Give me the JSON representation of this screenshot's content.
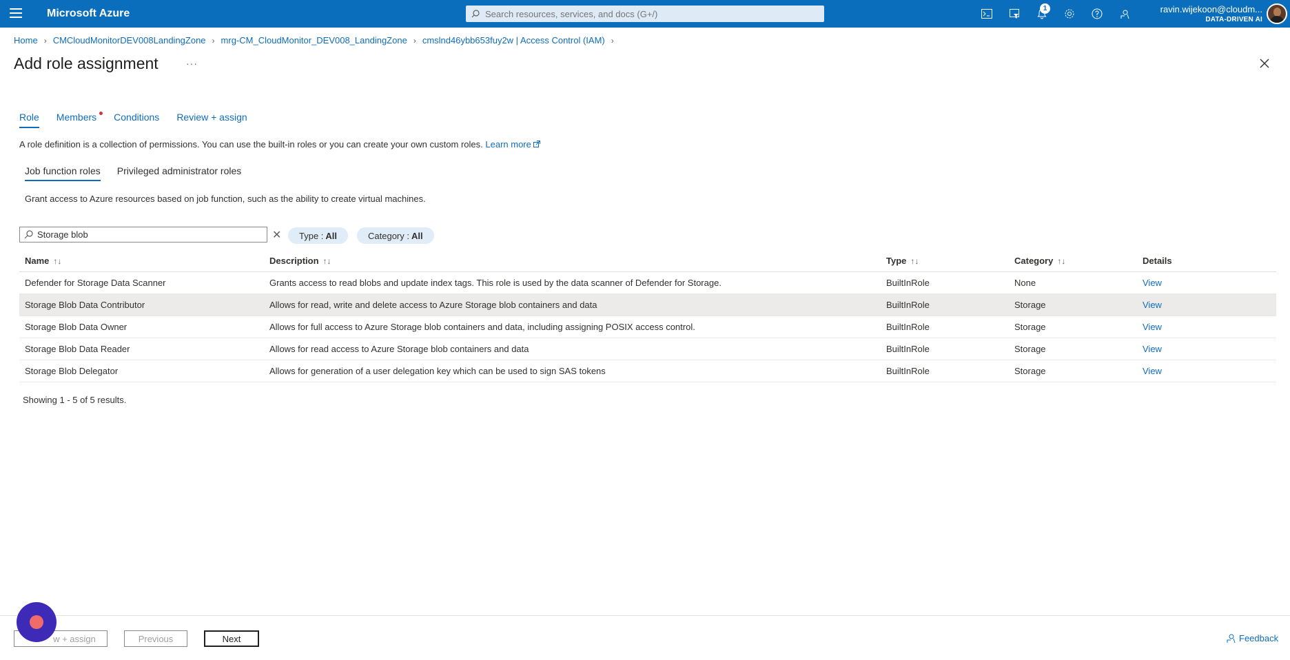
{
  "topbar": {
    "brand": "Microsoft Azure",
    "search_placeholder": "Search resources, services, and docs (G+/)",
    "notification_count": "1",
    "user_name": "ravin.wijekoon@cloudm...",
    "user_org": "DATA-DRIVEN AI",
    "icons": [
      "menu-icon",
      "cloud-shell-icon",
      "directory-filter-icon",
      "notifications-icon",
      "settings-icon",
      "help-icon",
      "feedback-icon"
    ]
  },
  "breadcrumb": [
    "Home",
    "CMCloudMonitorDEV008LandingZone",
    "mrg-CM_CloudMonitor_DEV008_LandingZone",
    "cmslnd46ybb653fuy2w | Access Control (IAM)"
  ],
  "page": {
    "title": "Add role assignment",
    "more_label": "···"
  },
  "tabs": [
    {
      "label": "Role",
      "active": true
    },
    {
      "label": "Members",
      "active": false,
      "has_dot": true
    },
    {
      "label": "Conditions",
      "active": false
    },
    {
      "label": "Review + assign",
      "active": false
    }
  ],
  "intro": {
    "text": "A role definition is a collection of permissions. You can use the built-in roles or you can create your own custom roles.",
    "link": "Learn more"
  },
  "subtabs": [
    {
      "label": "Job function roles",
      "active": true
    },
    {
      "label": "Privileged administrator roles",
      "active": false
    }
  ],
  "description": "Grant access to Azure resources based on job function, such as the ability to create virtual machines.",
  "filter": {
    "value": "Storage blob",
    "type_label": "Type : ",
    "type_value": "All",
    "category_label": "Category : ",
    "category_value": "All"
  },
  "table": {
    "headers": [
      "Name",
      "Description",
      "Type",
      "Category",
      "Details"
    ],
    "rows": [
      {
        "name": "Defender for Storage Data Scanner",
        "description": "Grants access to read blobs and update index tags. This role is used by the data scanner of Defender for Storage.",
        "type": "BuiltInRole",
        "category": "None",
        "details": "View"
      },
      {
        "name": "Storage Blob Data Contributor",
        "description": "Allows for read, write and delete access to Azure Storage blob containers and data",
        "type": "BuiltInRole",
        "category": "Storage",
        "details": "View"
      },
      {
        "name": "Storage Blob Data Owner",
        "description": "Allows for full access to Azure Storage blob containers and data, including assigning POSIX access control.",
        "type": "BuiltInRole",
        "category": "Storage",
        "details": "View"
      },
      {
        "name": "Storage Blob Data Reader",
        "description": "Allows for read access to Azure Storage blob containers and data",
        "type": "BuiltInRole",
        "category": "Storage",
        "details": "View"
      },
      {
        "name": "Storage Blob Delegator",
        "description": "Allows for generation of a user delegation key which can be used to sign SAS tokens",
        "type": "BuiltInRole",
        "category": "Storage",
        "details": "View"
      }
    ],
    "selected_index": 1
  },
  "showing": "Showing 1 - 5 of 5 results.",
  "footer": {
    "review_label": "w + assign",
    "previous_label": "Previous",
    "next_label": "Next",
    "feedback_label": "Feedback"
  }
}
